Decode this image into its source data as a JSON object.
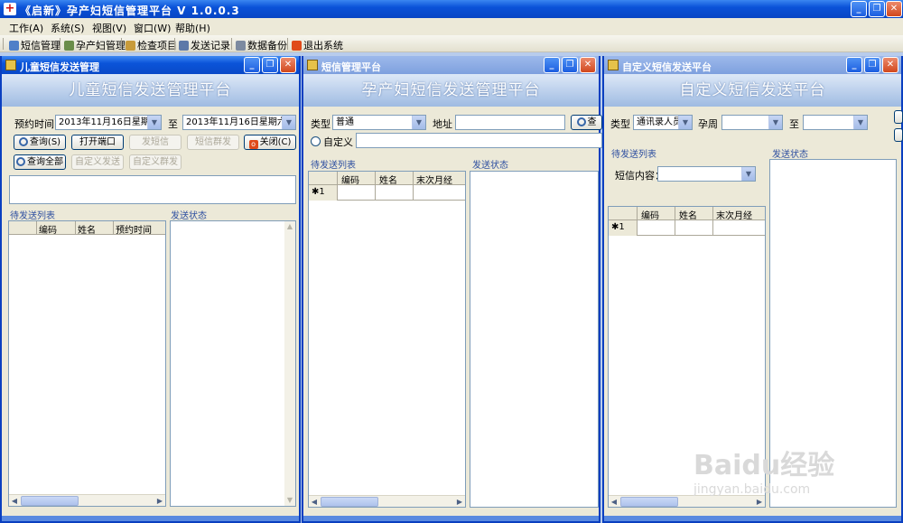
{
  "app": {
    "title": "《启新》孕产妇短信管理平台 V 1.0.0.3",
    "icon_char": "+"
  },
  "window_buttons": {
    "min": "_",
    "max": "❐",
    "close": "✕"
  },
  "menu": [
    {
      "label": "工作(A)"
    },
    {
      "label": "系统(S)"
    },
    {
      "label": "视图(V)"
    },
    {
      "label": "窗口(W)"
    },
    {
      "label": "帮助(H)"
    }
  ],
  "toolbar": [
    {
      "label": "短信管理",
      "icon": "filter-icon"
    },
    {
      "label": "孕产妇管理",
      "icon": "people-icon"
    },
    {
      "label": "检查项目",
      "icon": "checklist-icon"
    },
    {
      "label": "发送记录",
      "icon": "search-doc-icon"
    },
    {
      "label": "数据备份",
      "icon": "database-icon"
    },
    {
      "label": "退出系统",
      "icon": "exit-icon"
    }
  ],
  "child_win": {
    "title": "儿童短信发送管理",
    "banner": "儿童短信发送管理平台",
    "appointment_label": "预约时间",
    "date_from": "2013年11月16日星期六",
    "to_label": "至",
    "date_to": "2013年11月16日星期六",
    "buttons": {
      "query": "查询(S)",
      "open_port": "打开端口",
      "send_sms": "发短信",
      "group_sms": "短信群发",
      "close": "关闭(C)",
      "query_all": "查询全部",
      "custom_send": "自定义发送",
      "custom_group": "自定义群发"
    },
    "pending_label": "待发送列表",
    "status_label": "发送状态",
    "columns": [
      "编码",
      "姓名",
      "预约时间"
    ]
  },
  "sms_win": {
    "title": "短信管理平台",
    "banner": "孕产妇短信发送管理平台",
    "type_label": "类型",
    "type_value": "普通",
    "address_label": "地址",
    "query_btn": "查",
    "custom_radio": "自定义",
    "pending_label": "待发送列表",
    "status_label": "发送状态",
    "columns": [
      "编码",
      "姓名",
      "末次月经"
    ],
    "row_marker": "✱1"
  },
  "custom_win": {
    "title": "自定义短信发送平台",
    "banner": "自定义短信发送平台",
    "type_label": "类型",
    "type_value": "通讯录人员",
    "week_label": "孕周",
    "to_label": "至",
    "pending_label": "待发送列表",
    "sms_content_label": "短信内容：",
    "status_label": "发送状态",
    "columns": [
      "编码",
      "姓名",
      "末次月经"
    ],
    "row_marker": "✱1"
  },
  "watermark": {
    "brand": "Baidu经验",
    "url": "jingyan.baidu.com"
  }
}
